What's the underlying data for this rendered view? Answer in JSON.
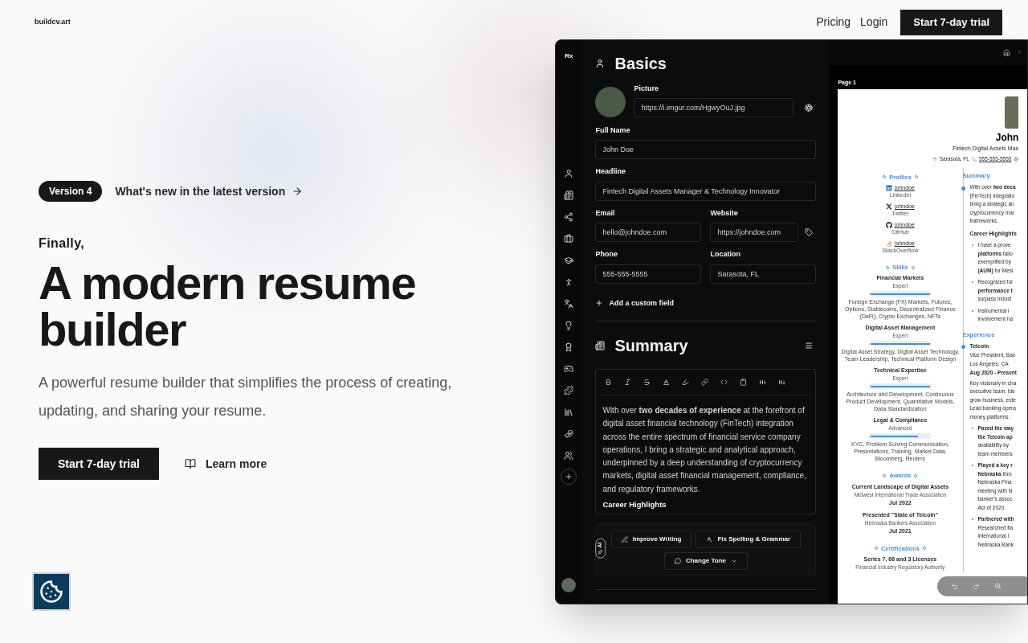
{
  "nav": {
    "logo": "buildcv.art",
    "links": [
      {
        "label": "Pricing"
      },
      {
        "label": "Login"
      }
    ],
    "cta": "Start 7-day trial"
  },
  "hero": {
    "badge": "Version 4",
    "news_link": "What's new in the latest version",
    "eyebrow": "Finally,",
    "title": "A modern resume builder",
    "description": "A powerful resume builder that simplifies the process of creating, updating, and sharing your resume.",
    "primary_button": "Start 7-day trial",
    "secondary_button": "Learn more"
  },
  "app": {
    "logo": "Rx",
    "basics": {
      "title": "Basics",
      "picture_label": "Picture",
      "picture_url": "https://i.imgur.com/HgwyOuJ.jpg",
      "add_field": "Add a custom field",
      "field_rows": [
        [
          {
            "label": "Full Name",
            "value": "John Doe",
            "kind": "text"
          }
        ],
        [
          {
            "label": "Headline",
            "value": "Fintech Digital Assets Manager & Technology Innovator",
            "kind": "text"
          }
        ],
        [
          {
            "label": "Email",
            "value": "hello@johndoe.com",
            "kind": "text"
          },
          {
            "label": "Website",
            "value": "https://johndoe.com",
            "kind": "url"
          }
        ],
        [
          {
            "label": "Phone",
            "value": "555-555-5555",
            "kind": "text"
          },
          {
            "label": "Location",
            "value": "Sarasota, FL",
            "kind": "text"
          }
        ]
      ]
    },
    "summary": {
      "title": "Summary",
      "text": "With over **two decades of experience** at the forefront of digital asset financial technology (FinTech) integration across the entire spectrum of financial service company operations, I bring a strategic and analytical approach, underpinned by a deep understanding of cryptocurrency markets, digital asset financial management, compliance, and regulatory frameworks.",
      "subheading": "Career Highlights",
      "ai_badge": "AI",
      "ai_actions": [
        "Improve Writing",
        "Fix Spelling & Grammar"
      ],
      "tone_button": "Change Tone"
    },
    "preview": {
      "breadcrumb_separator": "/",
      "page_label": "Page 1",
      "resume": {
        "name": "John",
        "headline": "Fintech Digital Assets Man",
        "contacts": [
          "Sarasota, FL",
          "555-555-5555"
        ],
        "profiles_title": "Profiles",
        "profiles": [
          {
            "username": "johndoe",
            "network": "LinkedIn"
          },
          {
            "username": "johndoe",
            "network": "Twitter"
          },
          {
            "username": "johndoe",
            "network": "GitHub"
          },
          {
            "username": "johndoe",
            "network": "StackOverflow"
          }
        ],
        "skills_title": "Skills",
        "skills": [
          {
            "name": "Financial Markets",
            "level_label": "Expert",
            "level": 1,
            "keywords": "Foreign Exchange (FX) Markets, Futures, Options, Stablecoins, Decentralized Finance (DeFi), Crypto Exchanges, NFTs"
          },
          {
            "name": "Digital Asset Management",
            "level_label": "Expert",
            "level": 1,
            "keywords": "Digital Asset Strategy, Digital Asset Technology, Team Leadership, Technical Platform Design"
          },
          {
            "name": "Technical Expertise",
            "level_label": "Expert",
            "level": 1,
            "keywords": "Architecture and Development, Continuous Product Development, Quantitative Models, Data Standardization"
          },
          {
            "name": "Legal & Compliance",
            "level_label": "Advanced",
            "level": 0.8,
            "keywords": "KYC, Problem Solving Communication, Presentations, Training, Market Data, Bloomberg, Reuters"
          }
        ],
        "awards_title": "Awards",
        "awards": [
          {
            "title": "Current Landscape of Digital Assets",
            "awarder": "Midwest International Trade Association",
            "date": "Jul 2022"
          },
          {
            "title": "Presented \"State of Telcoin\"",
            "awarder": "Nebraska Bankers Association",
            "date": "Jul 2021"
          }
        ],
        "certifications_title": "Certifications",
        "certifications": [
          {
            "title": "Series 7, 66 and 3 Licenses",
            "issuer": "Financial Industry Regulatory Authority"
          }
        ],
        "summary_title": "Summary",
        "summary_lines": [
          "With over **two deca**",
          "(FinTech) integratio",
          "bring a strategic an",
          "cryptocurrency mar",
          "frameworks."
        ],
        "highlights_title": "Career Highlights",
        "highlights": [
          [
            "I have a prove",
            "**platforms** tailo",
            "exemplified by",
            "**(AUM)** for Mesi"
          ],
          [
            "Recognized for",
            "**performance t**",
            "surpass indust"
          ],
          [
            "Instrumental i",
            "involvement ha"
          ]
        ],
        "experience_title": "Experience",
        "experience": {
          "company": "Telcoin",
          "position": "Vice President, Ban",
          "location": "Los Angeles, CA",
          "date": "Aug 2020 - Present",
          "description_lines": [
            "Key visionary in cha",
            "executive team. Ide",
            "grow business, exte",
            "Lead banking opera",
            "money platforms."
          ],
          "bullets": [
            [
              "**Paved the way**",
              "**the Telcoin ap**",
              "availability by",
              "team members"
            ],
            [
              "**Played a key r**",
              "**Nebraska** thro",
              "Nebraska Fina",
              "meeting with N",
              "banker's assoc",
              "Act of 2020."
            ],
            [
              "**Partnered with**",
              "Researched fia",
              "international l",
              "Nebraska Bank"
            ]
          ]
        }
      }
    }
  }
}
